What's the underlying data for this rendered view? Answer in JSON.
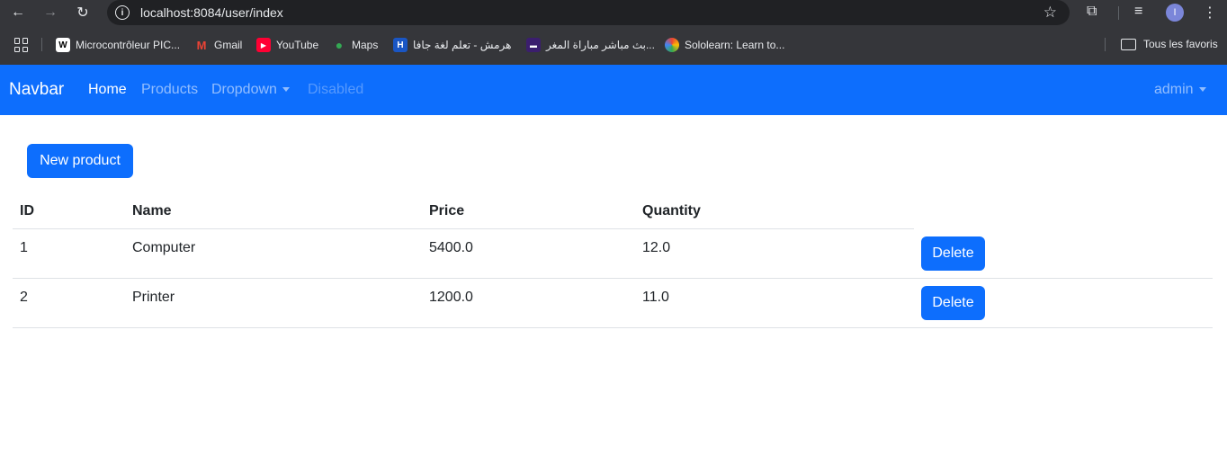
{
  "browser": {
    "url": "localhost:8084/user/index",
    "profile_initial": "I",
    "bookmarks": [
      {
        "label": "Microcontrôleur PIC...",
        "icon": "wikipedia-icon"
      },
      {
        "label": "Gmail",
        "icon": "gmail-icon"
      },
      {
        "label": "YouTube",
        "icon": "youtube-icon"
      },
      {
        "label": "Maps",
        "icon": "maps-icon"
      },
      {
        "label": "هرمش - تعلم لغة جافا",
        "icon": "h-site-icon"
      },
      {
        "label": "بث مباشر مباراة المغر...",
        "icon": "stream-icon"
      },
      {
        "label": "Sololearn: Learn to...",
        "icon": "sololearn-icon"
      }
    ],
    "all_bookmarks_label": "Tous les favoris"
  },
  "navbar": {
    "brand": "Navbar",
    "links": {
      "home": "Home",
      "products": "Products",
      "dropdown": "Dropdown",
      "disabled": "Disabled"
    },
    "user": "admin"
  },
  "main": {
    "new_button": "New product",
    "table": {
      "headers": [
        "ID",
        "Name",
        "Price",
        "Quantity"
      ],
      "rows": [
        {
          "id": "1",
          "name": "Computer",
          "price": "5400.0",
          "quantity": "12.0",
          "action": "Delete"
        },
        {
          "id": "2",
          "name": "Printer",
          "price": "1200.0",
          "quantity": "11.0",
          "action": "Delete"
        }
      ]
    }
  },
  "colors": {
    "primary": "#0d6efd",
    "browser_chrome": "#35363a"
  }
}
